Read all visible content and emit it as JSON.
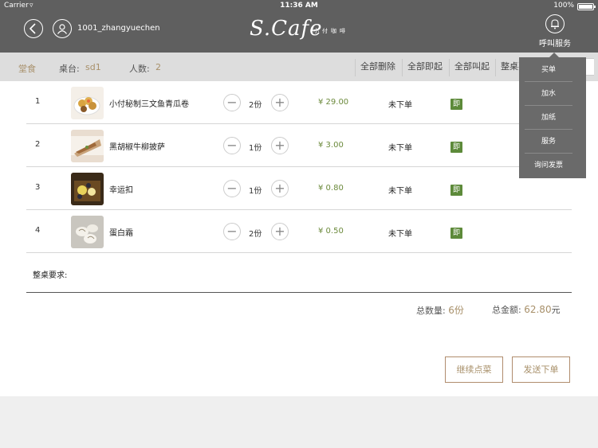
{
  "status_bar": {
    "carrier": "Carrier",
    "time": "11:36 AM",
    "battery": "100%"
  },
  "header": {
    "username": "1001_zhangyuechen",
    "logo": "S.Cafe",
    "logo_sub": "小付咖啡",
    "service_label": "呼叫服务"
  },
  "subheader": {
    "tab": "堂食",
    "table_label": "桌台:",
    "table_value": "sd1",
    "people_label": "人数:",
    "people_value": "2",
    "actions": [
      "全部删除",
      "全部即起",
      "全部叫起",
      "整桌要求"
    ]
  },
  "orders": [
    {
      "index": "1",
      "name": "小付秘制三文鱼青瓜卷",
      "qty": "2份",
      "price": "¥ 29.00",
      "status": "未下单",
      "badge": "即"
    },
    {
      "index": "2",
      "name": "黑胡椒牛柳披萨",
      "qty": "1份",
      "price": "¥ 3.00",
      "status": "未下单",
      "badge": "即"
    },
    {
      "index": "3",
      "name": "幸运扣",
      "qty": "1份",
      "price": "¥ 0.80",
      "status": "未下单",
      "badge": "即"
    },
    {
      "index": "4",
      "name": "蛋白霜",
      "qty": "2份",
      "price": "¥ 0.50",
      "status": "未下单",
      "badge": "即"
    }
  ],
  "remark_label": "整桌要求:",
  "totals": {
    "count_label": "总数量:",
    "count_value": "6份",
    "amount_label": "总金额:",
    "amount_value": "62.80",
    "amount_unit": "元"
  },
  "buttons": {
    "continue": "继续点菜",
    "submit": "发送下单"
  },
  "dropdown": [
    "买单",
    "加水",
    "加纸",
    "服务",
    "询问发票"
  ],
  "colors": {
    "header_bg": "#5f5f5f",
    "accent": "#a8906a",
    "price_green": "#6c8a3c",
    "badge_green": "#5d8a3a"
  }
}
